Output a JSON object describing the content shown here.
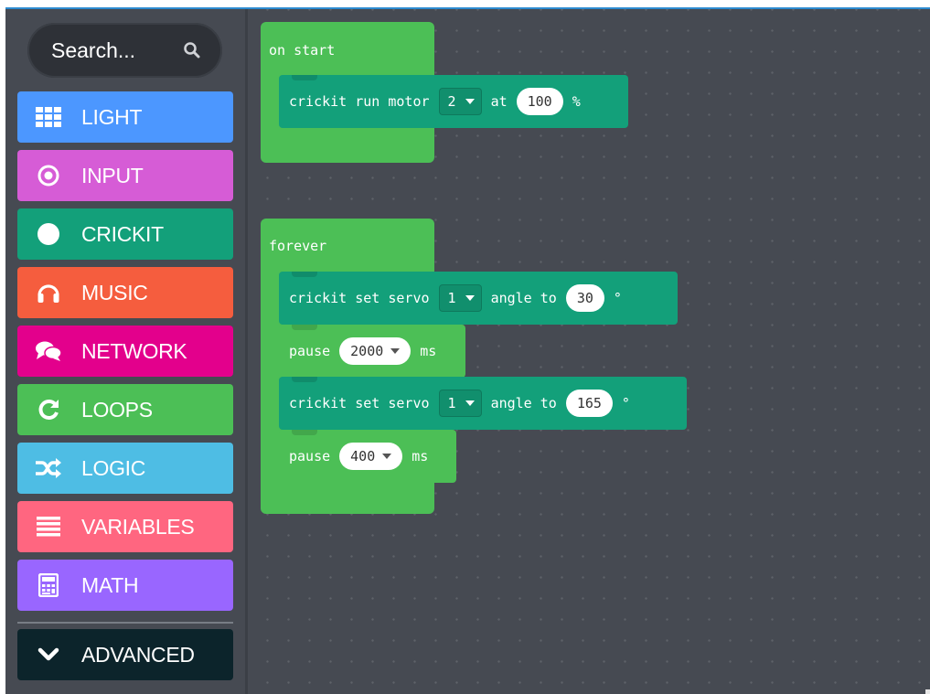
{
  "search": {
    "placeholder": "Search..."
  },
  "toolbox": {
    "categories": [
      {
        "label": "LIGHT",
        "icon": "grid-icon",
        "color": "#4c97ff"
      },
      {
        "label": "INPUT",
        "icon": "radio-target-icon",
        "color": "#d65cd6"
      },
      {
        "label": "CRICKIT",
        "icon": "circle-icon",
        "color": "#13a07a"
      },
      {
        "label": "MUSIC",
        "icon": "headphones-icon",
        "color": "#f55d3e"
      },
      {
        "label": "NETWORK",
        "icon": "chat-bubbles-icon",
        "color": "#e3008c"
      },
      {
        "label": "LOOPS",
        "icon": "refresh-icon",
        "color": "#4cbf56"
      },
      {
        "label": "LOGIC",
        "icon": "shuffle-icon",
        "color": "#4ebde4"
      },
      {
        "label": "VARIABLES",
        "icon": "list-lines-icon",
        "color": "#ff6680"
      },
      {
        "label": "MATH",
        "icon": "calculator-icon",
        "color": "#9966ff"
      }
    ],
    "advanced": {
      "label": "ADVANCED",
      "icon": "chevron-down-icon",
      "color": "#0c242b"
    }
  },
  "workspace": {
    "on_start": {
      "label": "on start",
      "motor_block": {
        "text": "crickit run motor",
        "motor": "2",
        "at": "at",
        "speed": "100",
        "unit": "%"
      }
    },
    "forever": {
      "label": "forever",
      "servo1": {
        "text": "crickit set servo",
        "servo": "1",
        "angle_label": "angle to",
        "angle": "30",
        "unit": "°"
      },
      "pause1": {
        "text": "pause",
        "value": "2000",
        "unit": "ms"
      },
      "servo2": {
        "text": "crickit set servo",
        "servo": "1",
        "angle_label": "angle to",
        "angle": "165",
        "unit": "°"
      },
      "pause2": {
        "text": "pause",
        "value": "400",
        "unit": "ms"
      }
    }
  }
}
